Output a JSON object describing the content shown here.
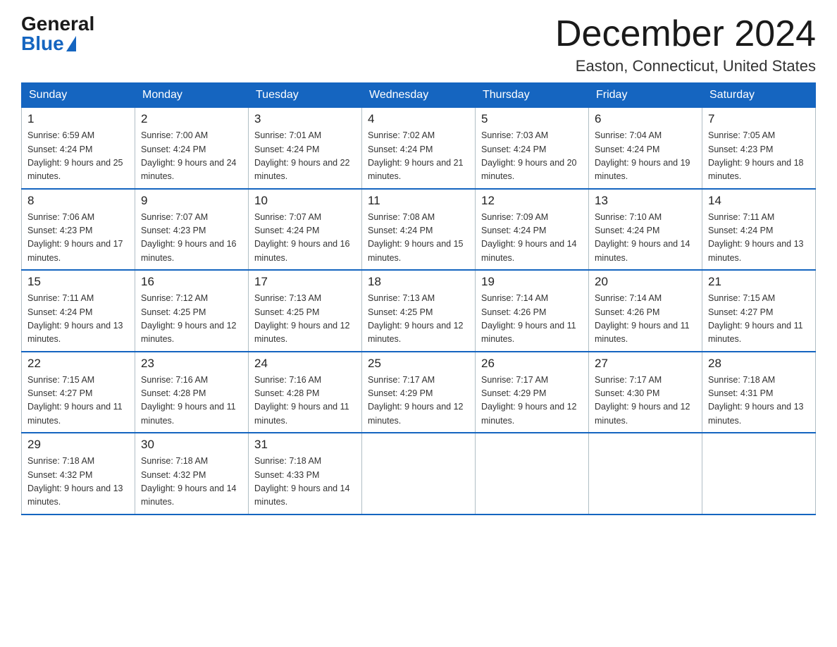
{
  "header": {
    "logo_general": "General",
    "logo_blue": "Blue",
    "month_title": "December 2024",
    "location": "Easton, Connecticut, United States"
  },
  "days_of_week": [
    "Sunday",
    "Monday",
    "Tuesday",
    "Wednesday",
    "Thursday",
    "Friday",
    "Saturday"
  ],
  "weeks": [
    [
      {
        "num": "1",
        "sunrise": "6:59 AM",
        "sunset": "4:24 PM",
        "daylight": "9 hours and 25 minutes."
      },
      {
        "num": "2",
        "sunrise": "7:00 AM",
        "sunset": "4:24 PM",
        "daylight": "9 hours and 24 minutes."
      },
      {
        "num": "3",
        "sunrise": "7:01 AM",
        "sunset": "4:24 PM",
        "daylight": "9 hours and 22 minutes."
      },
      {
        "num": "4",
        "sunrise": "7:02 AM",
        "sunset": "4:24 PM",
        "daylight": "9 hours and 21 minutes."
      },
      {
        "num": "5",
        "sunrise": "7:03 AM",
        "sunset": "4:24 PM",
        "daylight": "9 hours and 20 minutes."
      },
      {
        "num": "6",
        "sunrise": "7:04 AM",
        "sunset": "4:24 PM",
        "daylight": "9 hours and 19 minutes."
      },
      {
        "num": "7",
        "sunrise": "7:05 AM",
        "sunset": "4:23 PM",
        "daylight": "9 hours and 18 minutes."
      }
    ],
    [
      {
        "num": "8",
        "sunrise": "7:06 AM",
        "sunset": "4:23 PM",
        "daylight": "9 hours and 17 minutes."
      },
      {
        "num": "9",
        "sunrise": "7:07 AM",
        "sunset": "4:23 PM",
        "daylight": "9 hours and 16 minutes."
      },
      {
        "num": "10",
        "sunrise": "7:07 AM",
        "sunset": "4:24 PM",
        "daylight": "9 hours and 16 minutes."
      },
      {
        "num": "11",
        "sunrise": "7:08 AM",
        "sunset": "4:24 PM",
        "daylight": "9 hours and 15 minutes."
      },
      {
        "num": "12",
        "sunrise": "7:09 AM",
        "sunset": "4:24 PM",
        "daylight": "9 hours and 14 minutes."
      },
      {
        "num": "13",
        "sunrise": "7:10 AM",
        "sunset": "4:24 PM",
        "daylight": "9 hours and 14 minutes."
      },
      {
        "num": "14",
        "sunrise": "7:11 AM",
        "sunset": "4:24 PM",
        "daylight": "9 hours and 13 minutes."
      }
    ],
    [
      {
        "num": "15",
        "sunrise": "7:11 AM",
        "sunset": "4:24 PM",
        "daylight": "9 hours and 13 minutes."
      },
      {
        "num": "16",
        "sunrise": "7:12 AM",
        "sunset": "4:25 PM",
        "daylight": "9 hours and 12 minutes."
      },
      {
        "num": "17",
        "sunrise": "7:13 AM",
        "sunset": "4:25 PM",
        "daylight": "9 hours and 12 minutes."
      },
      {
        "num": "18",
        "sunrise": "7:13 AM",
        "sunset": "4:25 PM",
        "daylight": "9 hours and 12 minutes."
      },
      {
        "num": "19",
        "sunrise": "7:14 AM",
        "sunset": "4:26 PM",
        "daylight": "9 hours and 11 minutes."
      },
      {
        "num": "20",
        "sunrise": "7:14 AM",
        "sunset": "4:26 PM",
        "daylight": "9 hours and 11 minutes."
      },
      {
        "num": "21",
        "sunrise": "7:15 AM",
        "sunset": "4:27 PM",
        "daylight": "9 hours and 11 minutes."
      }
    ],
    [
      {
        "num": "22",
        "sunrise": "7:15 AM",
        "sunset": "4:27 PM",
        "daylight": "9 hours and 11 minutes."
      },
      {
        "num": "23",
        "sunrise": "7:16 AM",
        "sunset": "4:28 PM",
        "daylight": "9 hours and 11 minutes."
      },
      {
        "num": "24",
        "sunrise": "7:16 AM",
        "sunset": "4:28 PM",
        "daylight": "9 hours and 11 minutes."
      },
      {
        "num": "25",
        "sunrise": "7:17 AM",
        "sunset": "4:29 PM",
        "daylight": "9 hours and 12 minutes."
      },
      {
        "num": "26",
        "sunrise": "7:17 AM",
        "sunset": "4:29 PM",
        "daylight": "9 hours and 12 minutes."
      },
      {
        "num": "27",
        "sunrise": "7:17 AM",
        "sunset": "4:30 PM",
        "daylight": "9 hours and 12 minutes."
      },
      {
        "num": "28",
        "sunrise": "7:18 AM",
        "sunset": "4:31 PM",
        "daylight": "9 hours and 13 minutes."
      }
    ],
    [
      {
        "num": "29",
        "sunrise": "7:18 AM",
        "sunset": "4:32 PM",
        "daylight": "9 hours and 13 minutes."
      },
      {
        "num": "30",
        "sunrise": "7:18 AM",
        "sunset": "4:32 PM",
        "daylight": "9 hours and 14 minutes."
      },
      {
        "num": "31",
        "sunrise": "7:18 AM",
        "sunset": "4:33 PM",
        "daylight": "9 hours and 14 minutes."
      },
      {
        "num": "",
        "sunrise": "",
        "sunset": "",
        "daylight": ""
      },
      {
        "num": "",
        "sunrise": "",
        "sunset": "",
        "daylight": ""
      },
      {
        "num": "",
        "sunrise": "",
        "sunset": "",
        "daylight": ""
      },
      {
        "num": "",
        "sunrise": "",
        "sunset": "",
        "daylight": ""
      }
    ]
  ]
}
